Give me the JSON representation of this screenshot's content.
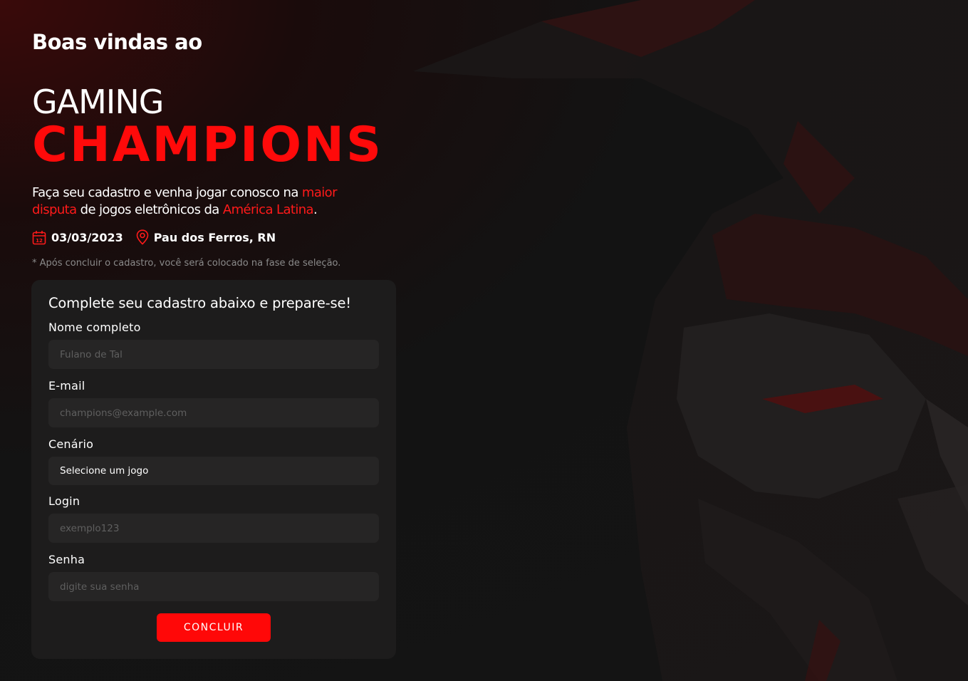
{
  "hero": {
    "welcome": "Boas vindas ao",
    "title_line1": "GAMING",
    "title_line2": "CHAMPIONS",
    "tagline_part1": "Faça seu cadastro e venha jogar conosco na ",
    "tagline_highlight1": "maior disputa",
    "tagline_part2": " de jogos eletrônicos da ",
    "tagline_highlight2": "América Latina",
    "tagline_part3": ".",
    "date": "03/03/2023",
    "location": "Pau dos Ferros, RN",
    "note": "* Após concluir o cadastro, você será colocado na fase de seleção."
  },
  "form": {
    "title": "Complete seu cadastro abaixo e prepare-se!",
    "name_label": "Nome completo",
    "name_placeholder": "Fulano de Tal",
    "email_label": "E-mail",
    "email_placeholder": "champions@example.com",
    "scenario_label": "Cenário",
    "scenario_selected": "Selecione um jogo",
    "login_label": "Login",
    "login_placeholder": "exemplo123",
    "password_label": "Senha",
    "password_placeholder": "digite sua senha",
    "submit_label": "CONCLUIR"
  },
  "colors": {
    "accent": "#ff0a0a",
    "card_bg": "#1d1c1c",
    "input_bg": "#262525"
  },
  "icons": {
    "date": "calendar-icon",
    "location": "map-pin-icon"
  }
}
